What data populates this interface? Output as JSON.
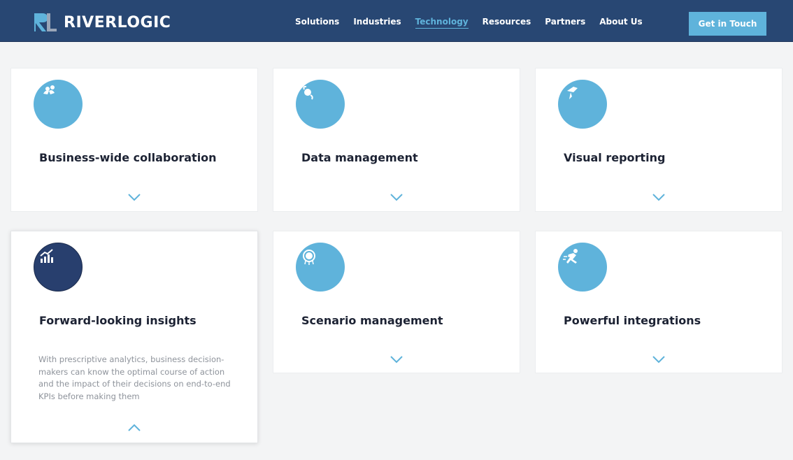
{
  "brand": {
    "name": "RIVERLOGIC",
    "mark": "RL"
  },
  "nav": {
    "items": [
      {
        "label": "Solutions"
      },
      {
        "label": "Industries"
      },
      {
        "label": "Technology",
        "active": true
      },
      {
        "label": "Resources"
      },
      {
        "label": "Partners"
      },
      {
        "label": "About Us"
      }
    ],
    "cta_label": "Get in Touch"
  },
  "colors": {
    "header_bg": "#284773",
    "accent": "#5fb3db",
    "dark_circle": "#283f6e",
    "page_bg": "#f3f4f5"
  },
  "cards": [
    {
      "title": "Business-wide collaboration",
      "icon": "collaboration-icon",
      "expanded": false
    },
    {
      "title": "Data management",
      "icon": "data-management-icon",
      "expanded": false
    },
    {
      "title": "Visual reporting",
      "icon": "visual-reporting-icon",
      "expanded": false
    },
    {
      "title": "Forward-looking insights",
      "icon": "insights-chart-icon",
      "expanded": true,
      "description": "With prescriptive analytics, business decision-makers can know the optimal course of action and the impact of their decisions on end-to-end KPIs before making them"
    },
    {
      "title": "Scenario management",
      "icon": "scenario-icon",
      "expanded": false
    },
    {
      "title": "Powerful integrations",
      "icon": "integrations-runner-icon",
      "expanded": false
    }
  ]
}
